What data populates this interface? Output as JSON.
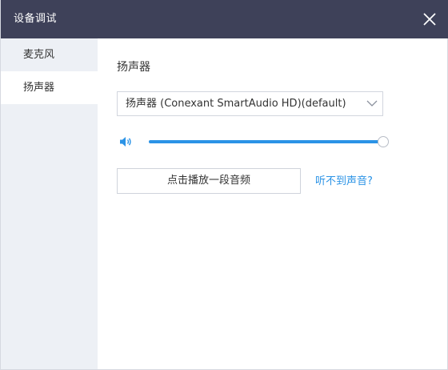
{
  "window": {
    "title": "设备调试",
    "close_icon": "close-icon"
  },
  "sidebar": {
    "items": [
      {
        "label": "麦克风",
        "selected": false
      },
      {
        "label": "扬声器",
        "selected": true
      }
    ]
  },
  "speaker": {
    "section_title": "扬声器",
    "device_select": {
      "value": "扬声器 (Conexant SmartAudio HD)(default)",
      "icon": "chevron-down-icon"
    },
    "volume": {
      "icon": "speaker-icon",
      "level": 1.0
    },
    "play_button_label": "点击播放一段音频",
    "help_link": "听不到声音?"
  },
  "colors": {
    "titlebar": "#3e4159",
    "sidebar_bg": "#edf0f5",
    "accent": "#2b93e6"
  }
}
